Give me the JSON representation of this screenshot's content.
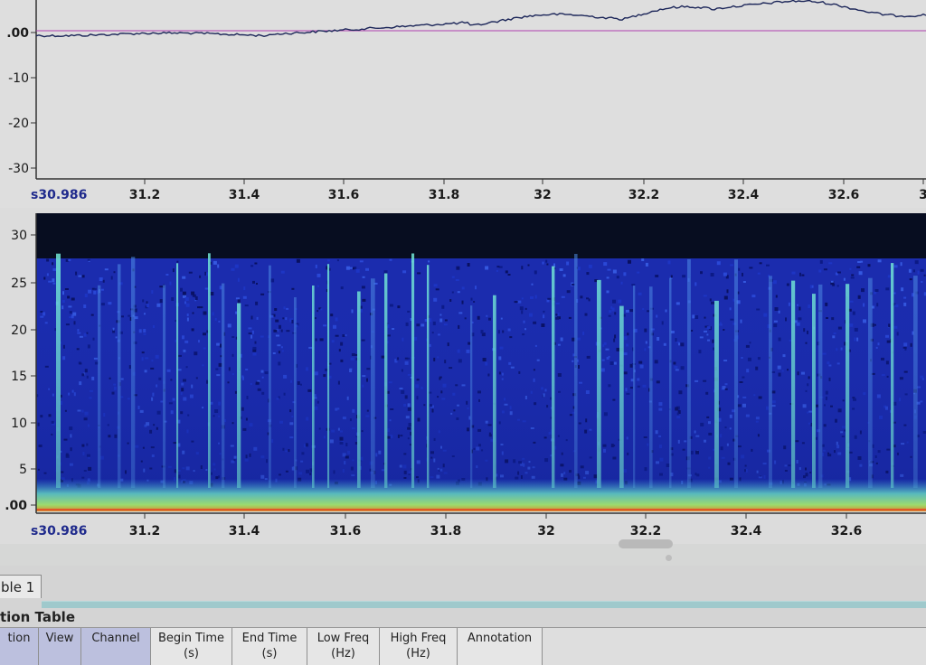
{
  "waveform": {
    "y_ticks": [
      ".00",
      "-10",
      "-20",
      "-30"
    ],
    "x_axis": {
      "start_label": "s30.986",
      "tick_labels": [
        "31.2",
        "31.4",
        "31.6",
        "31.8",
        "32",
        "32.2",
        "32.4",
        "32.6",
        "3"
      ]
    },
    "colors": {
      "trace": "#1c2659",
      "zero_line": "#b040b0"
    }
  },
  "spectrogram": {
    "y_ticks": [
      "30",
      "25",
      "20",
      "15",
      "10",
      "5",
      ".00"
    ],
    "x_axis": {
      "start_label": "s30.986",
      "tick_labels": [
        "31.2",
        "31.4",
        "31.6",
        "31.8",
        "32",
        "32.2",
        "32.4",
        "32.6"
      ]
    },
    "colors": {
      "background": "#1a29ad",
      "top_band": "#060c1c",
      "bright": "#6fe8d8",
      "low_band": "#8fe07a"
    }
  },
  "tabs": [
    {
      "label": "ble 1"
    }
  ],
  "annotation_table": {
    "title": "tion Table",
    "columns": [
      {
        "line1": "tion",
        "line2": ""
      },
      {
        "line1": "View",
        "line2": ""
      },
      {
        "line1": "Channel",
        "line2": ""
      },
      {
        "line1": "Begin Time",
        "line2": "(s)"
      },
      {
        "line1": "End Time",
        "line2": "(s)"
      },
      {
        "line1": "Low Freq",
        "line2": "(Hz)"
      },
      {
        "line1": "High Freq",
        "line2": "(Hz)"
      },
      {
        "line1": "Annotation",
        "line2": ""
      }
    ]
  }
}
